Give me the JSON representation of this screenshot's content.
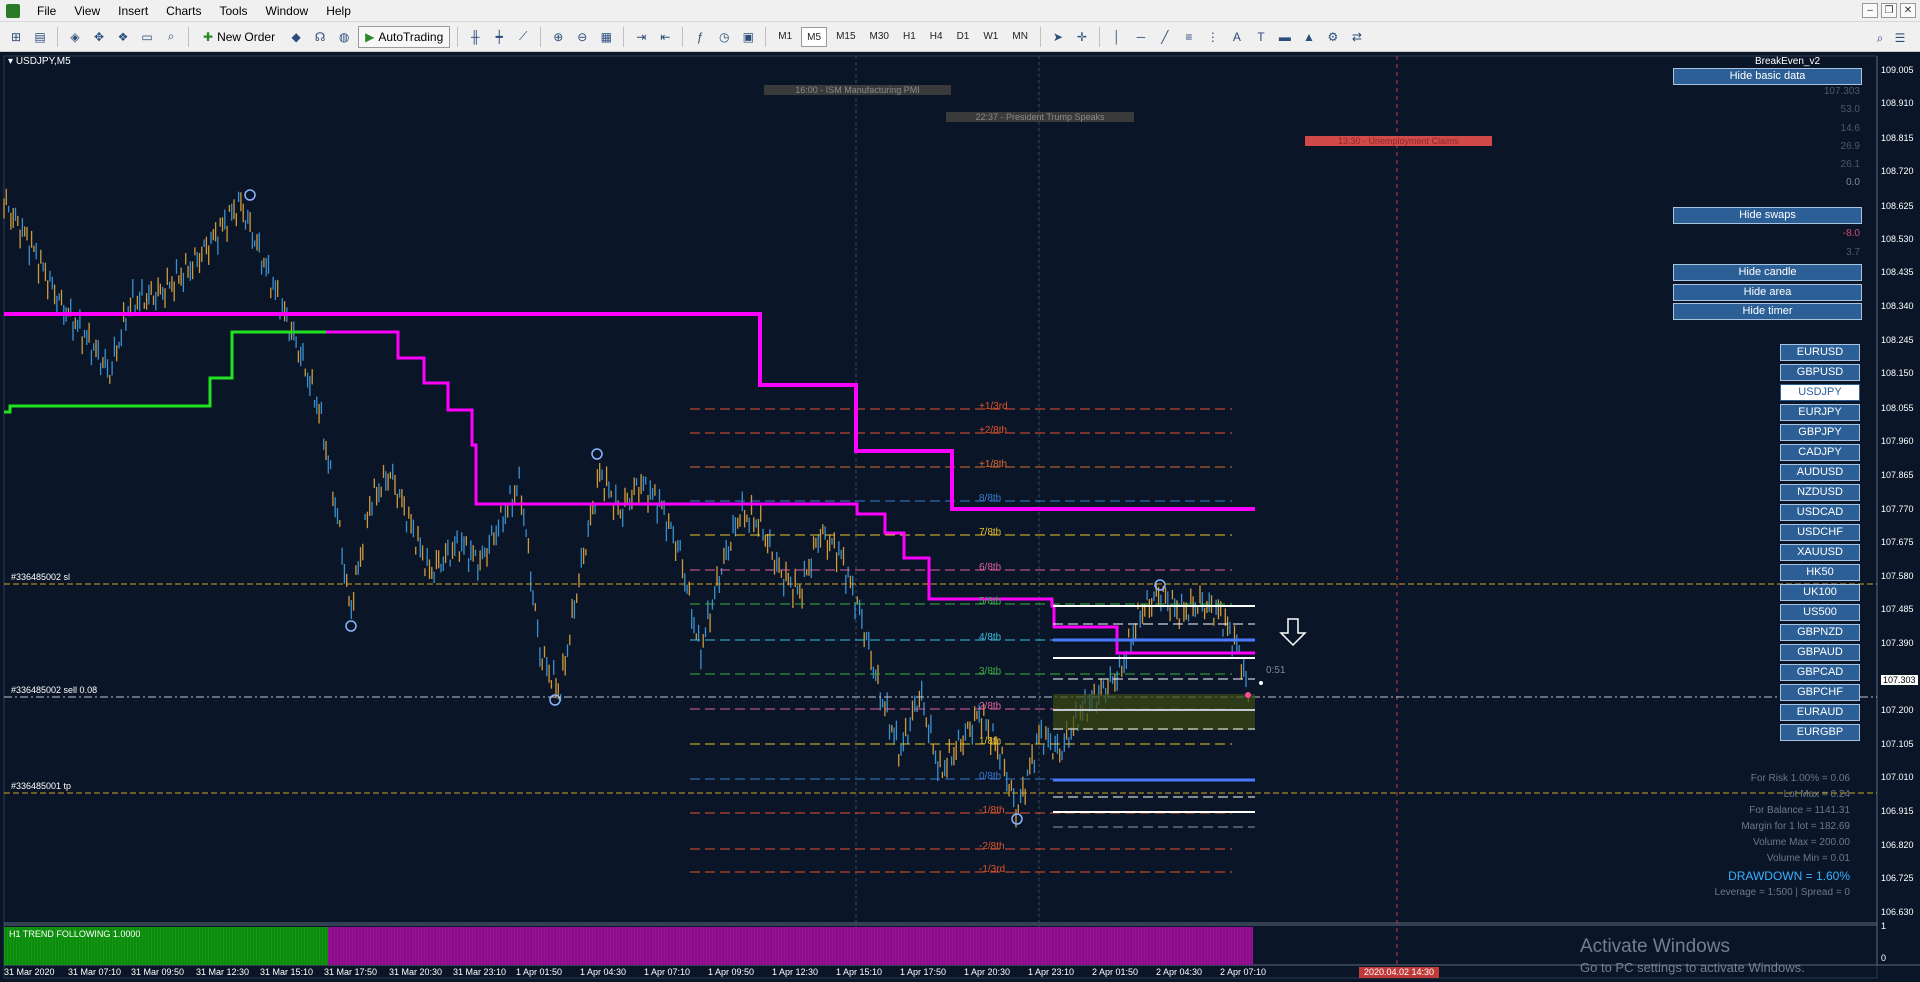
{
  "menu": {
    "items": [
      "File",
      "View",
      "Insert",
      "Charts",
      "Tools",
      "Window",
      "Help"
    ]
  },
  "toolbar": {
    "new_order": "New Order",
    "autotrading": "AutoTrading",
    "timeframes": [
      "M1",
      "M5",
      "M15",
      "M30",
      "H1",
      "H4",
      "D1",
      "W1",
      "MN"
    ],
    "active_timeframe": "M5"
  },
  "chart": {
    "symbol_label": "USDJPY,M5",
    "indicator_name": "BreakEven_v2",
    "current_price": "107.303",
    "price_axis": [
      "109.005",
      "108.910",
      "108.815",
      "108.720",
      "108.625",
      "108.530",
      "108.435",
      "108.340",
      "108.245",
      "108.150",
      "108.055",
      "107.960",
      "107.865",
      "107.770",
      "107.675",
      "107.580",
      "107.485",
      "107.390",
      "107.303",
      "107.200",
      "107.105",
      "107.010",
      "106.915",
      "106.820",
      "106.725",
      "106.630"
    ],
    "time_axis": [
      "31 Mar 2020",
      "31 Mar 07:10",
      "31 Mar 09:50",
      "31 Mar 12:30",
      "31 Mar 15:10",
      "31 Mar 17:50",
      "31 Mar 20:30",
      "31 Mar 23:10",
      "1 Apr 01:50",
      "1 Apr 04:30",
      "1 Apr 07:10",
      "1 Apr 09:50",
      "1 Apr 12:30",
      "1 Apr 15:10",
      "1 Apr 17:50",
      "1 Apr 20:30",
      "1 Apr 23:10",
      "2 Apr 01:50",
      "2 Apr 04:30",
      "2 Apr 07:10"
    ],
    "time_marker": "2020.04.02 14:30",
    "news": [
      {
        "text": "16:00 - ISM Manufacturing PMI",
        "color": "#3a3a3a"
      },
      {
        "text": "22:37 - President Trump Speaks",
        "color": "#3a3a3a"
      },
      {
        "text": "13:30 - Unemployment Claims",
        "color": "#d04a4a"
      }
    ],
    "orders": {
      "sl": "#336485002 sl",
      "sell": "#336485002 sell 0.08",
      "tp": "#336485001 tp"
    },
    "murrey_labels": [
      {
        "text": "+1/3rd",
        "color": "#e0542a"
      },
      {
        "text": "+2/8th",
        "color": "#e0542a"
      },
      {
        "text": "+1/8th",
        "color": "#e06a2a"
      },
      {
        "text": "8/8th",
        "color": "#3a7ad0"
      },
      {
        "text": "7/8th",
        "color": "#e8c22a"
      },
      {
        "text": "6/8th",
        "color": "#e060a0"
      },
      {
        "text": "5/8th",
        "color": "#3ab040"
      },
      {
        "text": "4/8th",
        "color": "#3ac0e0"
      },
      {
        "text": "3/8th",
        "color": "#3ab040"
      },
      {
        "text": "2/8th",
        "color": "#e060a0"
      },
      {
        "text": "1/8th",
        "color": "#e8c22a"
      },
      {
        "text": "0/8th",
        "color": "#3a7ad0"
      },
      {
        "text": "-1/8th",
        "color": "#e0542a"
      },
      {
        "text": "-2/8th",
        "color": "#e0542a"
      },
      {
        "text": "-1/3rd",
        "color": "#e0542a"
      }
    ],
    "timer": "0:51",
    "indicator_panel_label": "H1 TREND FOLLOWING 1.0000",
    "indicator_axis": [
      "1",
      "0"
    ]
  },
  "panel": {
    "hide_basic_data": "Hide basic data",
    "basic_values": [
      "107.303",
      "53.0",
      "14.6",
      "26.9",
      "26.1",
      "0.0"
    ],
    "hide_swaps": "Hide swaps",
    "swap_values": [
      "-8.0",
      "3.7"
    ],
    "hide_candle": "Hide candle",
    "hide_area": "Hide area",
    "hide_timer": "Hide timer",
    "symbols": [
      "EURUSD",
      "GBPUSD",
      "USDJPY",
      "EURJPY",
      "GBPJPY",
      "CADJPY",
      "AUDUSD",
      "NZDUSD",
      "USDCAD",
      "USDCHF",
      "XAUUSD",
      "HK50",
      "UK100",
      "US500",
      "GBPNZD",
      "GBPAUD",
      "GBPCAD",
      "GBPCHF",
      "EURAUD",
      "EURGBP"
    ],
    "active_symbol": "USDJPY",
    "info": {
      "risk": "For Risk 1.00% = 0.06",
      "lot_max": "Lot Max = 0.24",
      "balance": "For Balance = 1141.31",
      "margin": "Margin for 1 lot = 182.69",
      "volume_max": "Volume Max = 200.00",
      "volume_min": "Volume Min = 0.01",
      "drawdown": "DRAWDOWN =  1.60%",
      "leverage": "Leverage = 1:500 | Spread = 0"
    }
  },
  "watermark": {
    "title": "Activate Windows",
    "subtitle": "Go to PC settings to activate Windows."
  }
}
